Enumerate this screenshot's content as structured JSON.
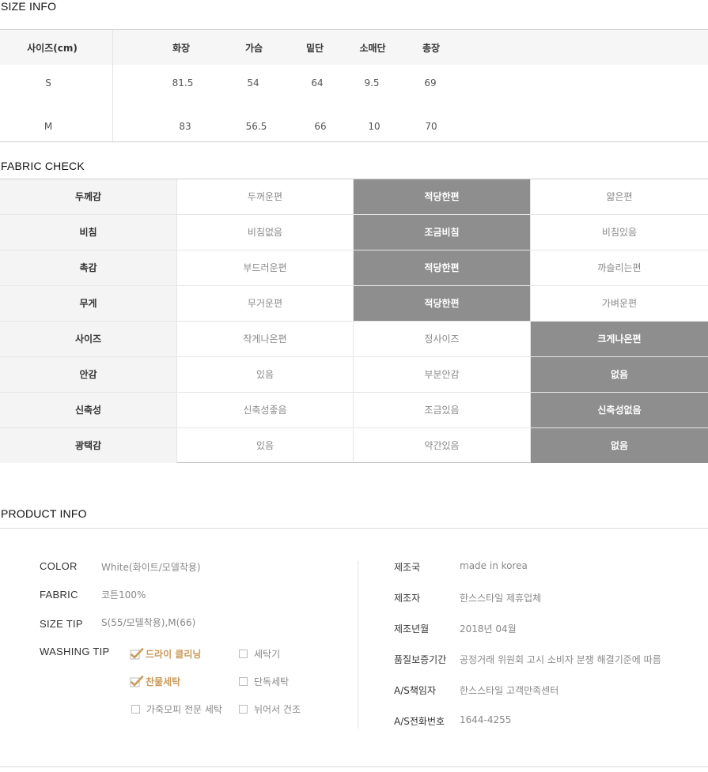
{
  "size_info": {
    "title": "SIZE INFO",
    "header": [
      "사이즈(cm)",
      "화장",
      "가슴",
      "밑단",
      "소매단",
      "총장"
    ],
    "rows": [
      [
        "S",
        "81.5",
        "54",
        "64",
        "9.5",
        "69"
      ],
      [
        "M",
        "83",
        "56.5",
        "66",
        "10",
        "70"
      ]
    ]
  },
  "fabric_check": {
    "title": "FABRIC CHECK",
    "selected_color": "#8e8e8e",
    "rows": [
      {
        "label": "두께감",
        "options": [
          "두꺼운편",
          "적당한편",
          "얇은편"
        ],
        "selected": 1
      },
      {
        "label": "비침",
        "options": [
          "비침없음",
          "조금비침",
          "비침있음"
        ],
        "selected": 1
      },
      {
        "label": "촉감",
        "options": [
          "부드러운편",
          "적당한편",
          "까슬리는편"
        ],
        "selected": 1
      },
      {
        "label": "무게",
        "options": [
          "무거운편",
          "적당한편",
          "가벼운편"
        ],
        "selected": 1
      },
      {
        "label": "사이즈",
        "options": [
          "작게나온편",
          "정사이즈",
          "크게나온편"
        ],
        "selected": 2
      },
      {
        "label": "안감",
        "options": [
          "있음",
          "부분안감",
          "없음"
        ],
        "selected": 2
      },
      {
        "label": "신축성",
        "options": [
          "신축성좋음",
          "조금있음",
          "신축성없음"
        ],
        "selected": 2
      },
      {
        "label": "광택감",
        "options": [
          "있음",
          "약간있음",
          "없음"
        ],
        "selected": 2
      }
    ]
  },
  "product_info": {
    "title": "PRODUCT INFO",
    "color_label": "COLOR",
    "color_value": "White(화이트/모델착용)",
    "fabric_label": "FABRIC",
    "fabric_value": "코튼100%",
    "size_tip_label": "SIZE TIP",
    "size_tip_value": "S(55/모델착용),M(66)",
    "washing_label": "WASHING TIP",
    "washing_accent": "#c89b5a",
    "washing": [
      {
        "label": "드라이 클리닝",
        "checked": true
      },
      {
        "label": "세탁기",
        "checked": false
      },
      {
        "label": "찬물세탁",
        "checked": true
      },
      {
        "label": "단독세탁",
        "checked": false
      },
      {
        "label": "가죽모피 전문 세탁",
        "checked": false
      },
      {
        "label": "뉘어서 건조",
        "checked": false
      }
    ],
    "details": [
      {
        "label": "제조국",
        "value": "made in korea"
      },
      {
        "label": "제조자",
        "value": "한스스타일 제휴업체"
      },
      {
        "label": "제조년월",
        "value": "2018년 04월"
      },
      {
        "label": "품질보증기간",
        "value": "공정거래 위원회 고시 소비자 분쟁 해결기준에 따름"
      },
      {
        "label": "A/S책임자",
        "value": "한스스타일 고객만족센터"
      },
      {
        "label": "A/S전화번호",
        "value": "1644-4255"
      }
    ]
  }
}
